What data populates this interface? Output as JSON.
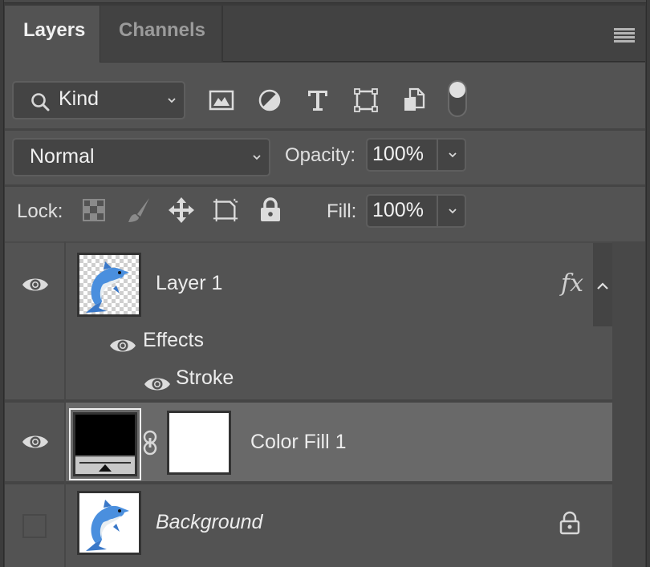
{
  "tabs": [
    {
      "label": "Layers",
      "active": true
    },
    {
      "label": "Channels",
      "active": false
    }
  ],
  "panel_menu_icon": "hamburger-menu-icon",
  "filter": {
    "kind_label": "Kind",
    "icons": [
      "image-filter-icon",
      "adjustment-filter-icon",
      "type-filter-icon",
      "shape-filter-icon",
      "smart-object-filter-icon"
    ],
    "toggle_on": true
  },
  "blend": {
    "mode": "Normal",
    "opacity_label": "Opacity:",
    "opacity_value": "100%"
  },
  "lock": {
    "label": "Lock:",
    "icons": [
      "lock-transparent-pixels-icon",
      "lock-image-pixels-icon",
      "lock-position-icon",
      "lock-artboard-icon",
      "lock-all-icon"
    ],
    "fill_label": "Fill:",
    "fill_value": "100%"
  },
  "layers": [
    {
      "name": "Layer 1",
      "visible": true,
      "fx_label": "fx",
      "effects_label": "Effects",
      "effects": [
        {
          "name": "Stroke",
          "visible": true
        }
      ]
    },
    {
      "name": "Color Fill 1",
      "visible": true,
      "selected": true
    },
    {
      "name": "Background",
      "visible": false,
      "locked": true
    }
  ],
  "colors": {
    "panel_bg": "#535353",
    "selected_row": "#696969",
    "dolphin_blue": "#4a8fde"
  }
}
